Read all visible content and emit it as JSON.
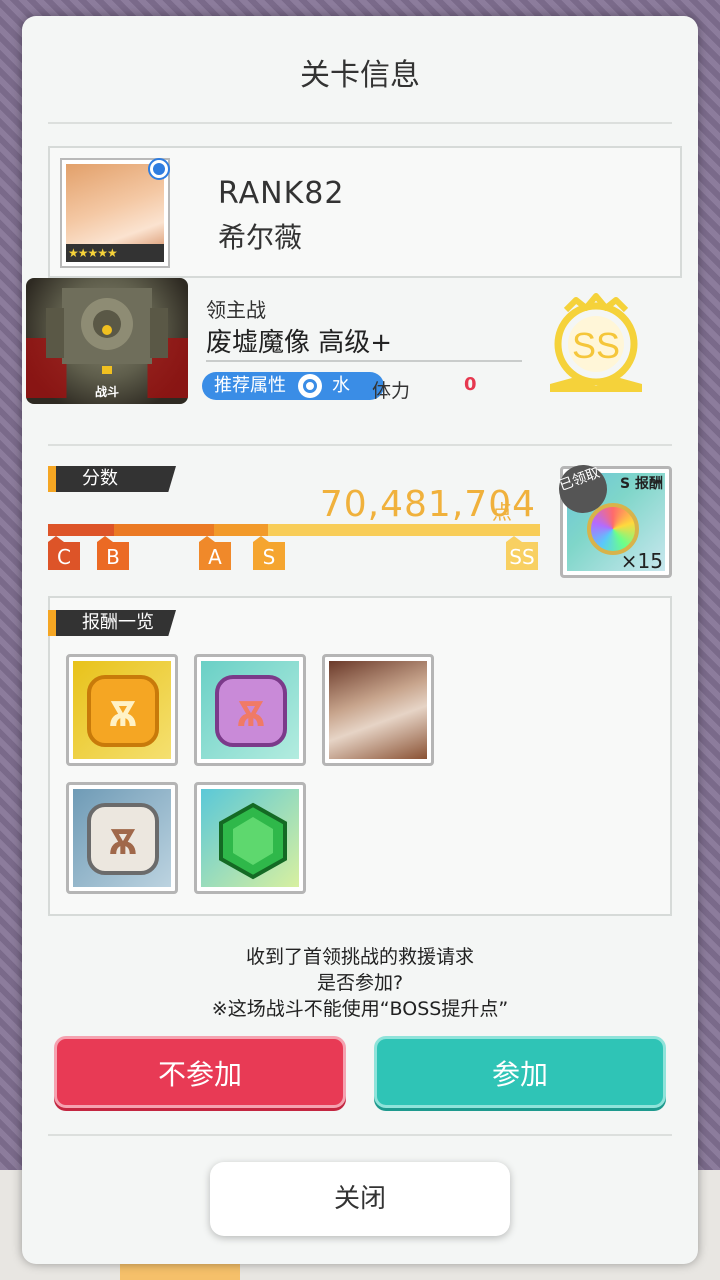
{
  "dialog": {
    "title": "关卡信息",
    "close_label": "关闭"
  },
  "player": {
    "rank": "RANK82",
    "name": "希尔薇",
    "stars": "★★★★★"
  },
  "boss": {
    "type": "领主战",
    "name": "废墟魔像 高级+",
    "image_label": "战斗",
    "attribute_label": "推荐属性",
    "attribute_value": "水",
    "stamina_label": "体力",
    "stamina_value": "0",
    "grade_badge": "SS"
  },
  "score": {
    "section_label": "分数",
    "value": "70,481,704",
    "unit": "点",
    "grades": [
      "C",
      "B",
      "A",
      "S",
      "SS"
    ]
  },
  "ss_reward": {
    "label": "S 报酬",
    "claimed_label": "已领取",
    "quantity": "×15"
  },
  "rewards": {
    "section_label": "报酬一览",
    "items": [
      {
        "name": "gold-medal"
      },
      {
        "name": "purple-medal"
      },
      {
        "name": "character-portrait"
      },
      {
        "name": "silver-medal"
      },
      {
        "name": "green-gem"
      }
    ]
  },
  "message": {
    "line1": "收到了首领挑战的救援请求",
    "line2": "是否参加?",
    "line3": "※这场战斗不能使用“BOSS提升点”"
  },
  "buttons": {
    "decline": "不参加",
    "join": "参加"
  },
  "colors": {
    "decline": "#e83a55",
    "join": "#2fc4b6",
    "score": "#f0b13c",
    "attribute": "#3a8de6"
  }
}
